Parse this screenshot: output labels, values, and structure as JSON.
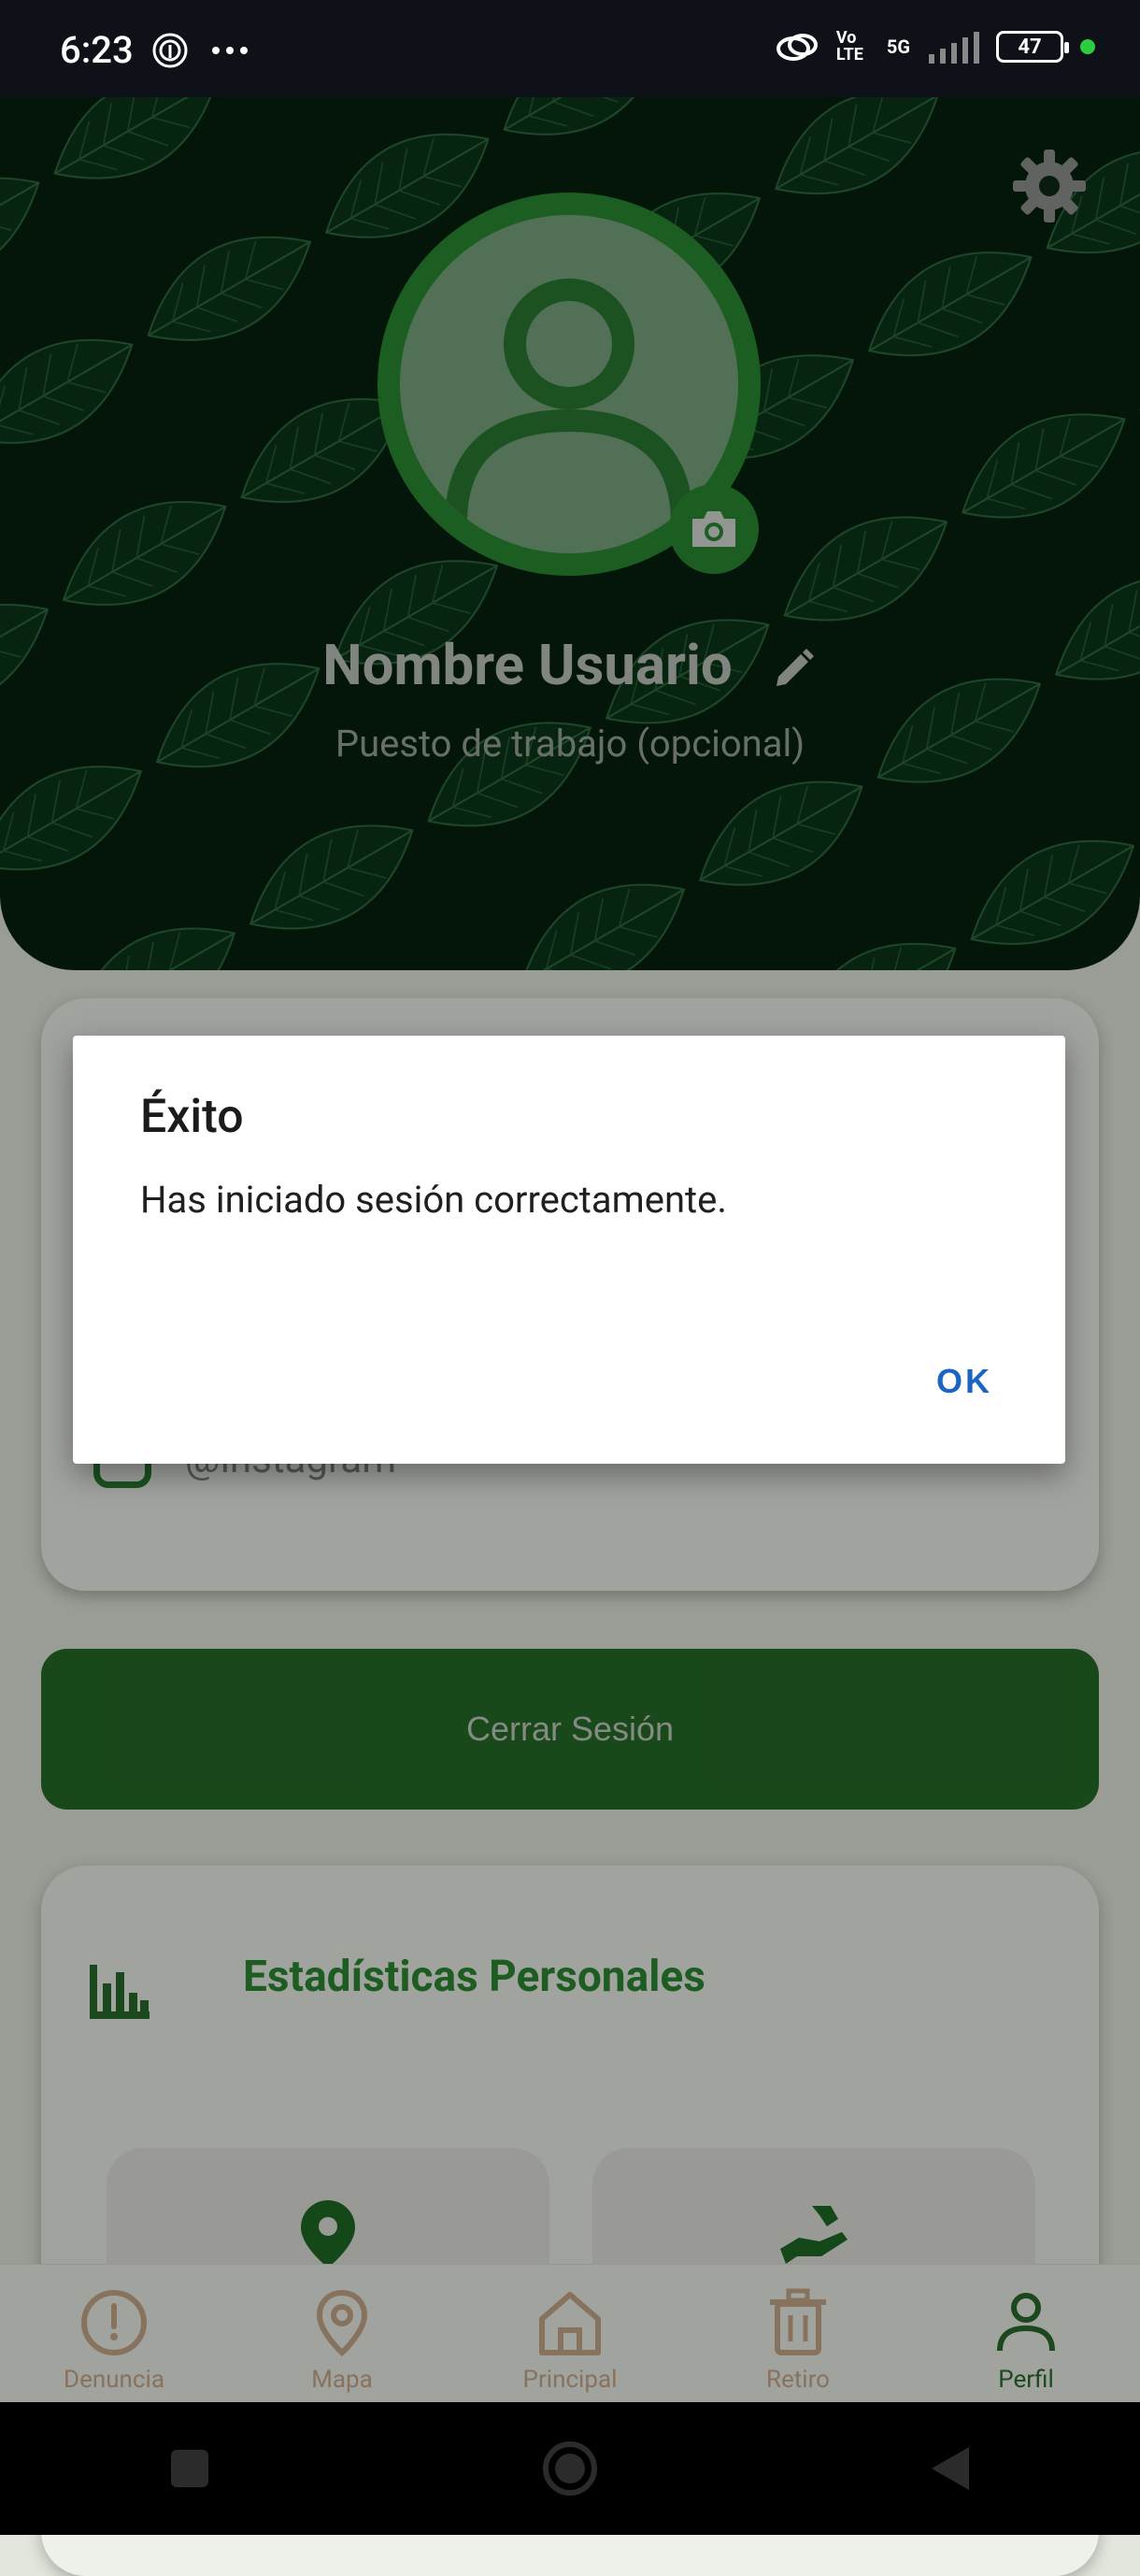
{
  "status_bar": {
    "time": "6:23",
    "battery": "47",
    "network": "5G",
    "volte": "Vo LTE"
  },
  "profile": {
    "name": "Nombre Usuario",
    "job_placeholder": "Puesto de trabajo (opcional)",
    "instagram": "@instagram"
  },
  "logout_label": "Cerrar Sesión",
  "stats": {
    "title": "Estadísticas Personales"
  },
  "nav": {
    "items": [
      {
        "label": "Denuncia",
        "icon": "alert-circle-icon"
      },
      {
        "label": "Mapa",
        "icon": "map-pin-icon"
      },
      {
        "label": "Principal",
        "icon": "home-icon"
      },
      {
        "label": "Retiro",
        "icon": "trash-icon"
      },
      {
        "label": "Perfil",
        "icon": "person-icon",
        "active": true
      }
    ]
  },
  "dialog": {
    "title": "Éxito",
    "message": "Has iniciado sesión correctamente.",
    "ok_label": "OK"
  },
  "colors": {
    "primary_green": "#2b8a33",
    "dark_green": "#266a29",
    "header_bg": "#06200f",
    "nav_inactive": "#c8a98a",
    "dialog_button": "#1a66c2"
  }
}
